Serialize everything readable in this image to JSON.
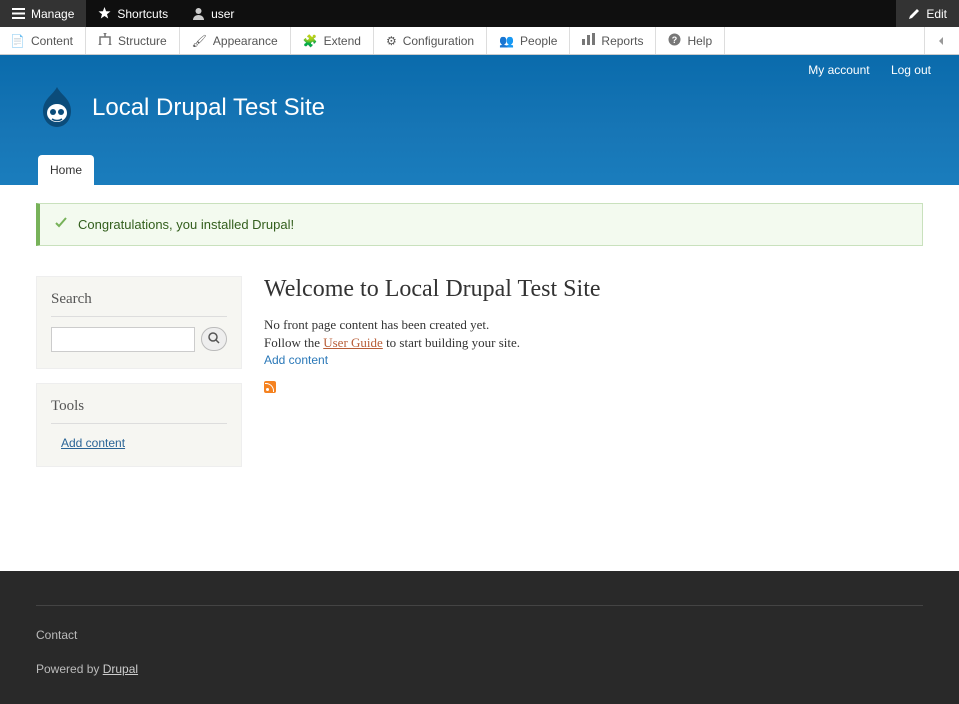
{
  "toolbar": {
    "manage": "Manage",
    "shortcuts": "Shortcuts",
    "user": "user",
    "edit": "Edit"
  },
  "admin_menu": {
    "content": "Content",
    "structure": "Structure",
    "appearance": "Appearance",
    "extend": "Extend",
    "configuration": "Configuration",
    "people": "People",
    "reports": "Reports",
    "help": "Help"
  },
  "user_links": {
    "my_account": "My account",
    "log_out": "Log out"
  },
  "site_name": "Local Drupal Test Site",
  "tabs": {
    "home": "Home"
  },
  "status": "Congratulations, you installed Drupal!",
  "sidebar": {
    "search_title": "Search",
    "tools_title": "Tools",
    "add_content": "Add content"
  },
  "main": {
    "heading": "Welcome to Local Drupal Test Site",
    "p1": "No front page content has been created yet.",
    "p2a": "Follow the ",
    "p2link": "User Guide",
    "p2b": " to start building your site.",
    "add_content": "Add content"
  },
  "footer": {
    "contact": "Contact",
    "powered_by": "Powered by ",
    "drupal": "Drupal"
  }
}
